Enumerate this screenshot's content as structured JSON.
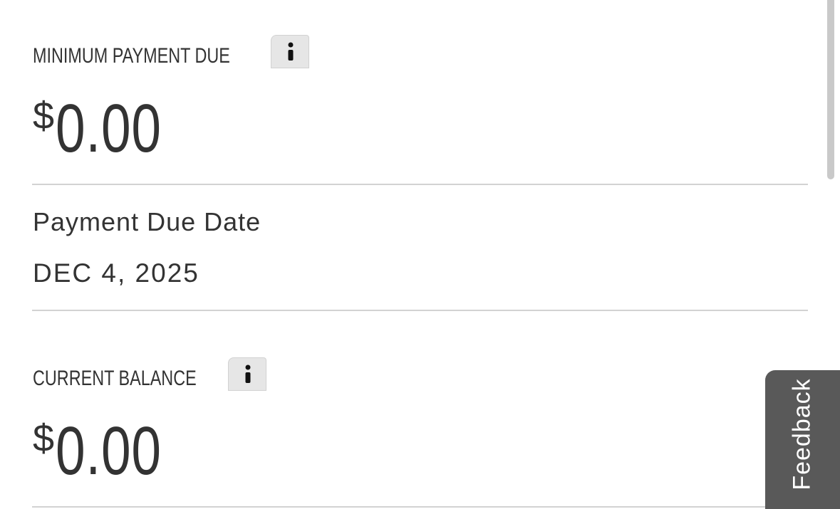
{
  "minimum_payment": {
    "label": "MINIMUM PAYMENT DUE",
    "currency_symbol": "$",
    "amount": "0.00",
    "info_icon": "info-icon"
  },
  "due_date": {
    "label": "Payment Due Date",
    "value": "DEC 4, 2025"
  },
  "current_balance": {
    "label": "CURRENT BALANCE",
    "currency_symbol": "$",
    "amount": "0.00",
    "info_icon": "info-icon"
  },
  "feedback_tab": {
    "label": "Feedback"
  },
  "colors": {
    "text": "#333333",
    "divider": "#d2d2d2",
    "info_button_bg": "#e6e6e6",
    "feedback_bg": "#595959"
  }
}
